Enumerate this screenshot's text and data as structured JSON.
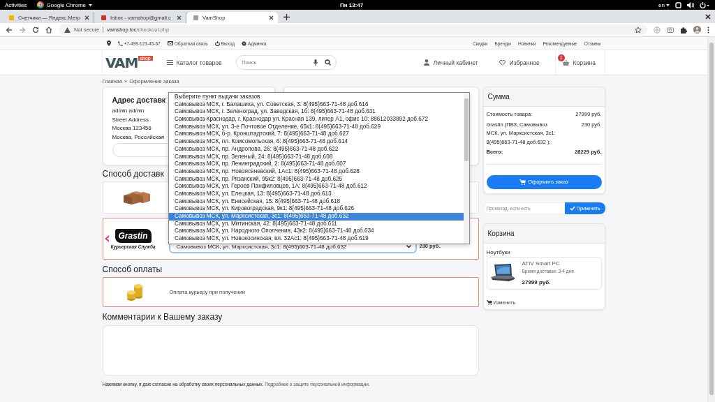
{
  "os_bar": {
    "activities": "Activities",
    "app": "Google Chrome",
    "clock": "Пн 13:47",
    "language": "en"
  },
  "browser": {
    "tabs": [
      {
        "title": "Счетчики — Яндекс.Метр",
        "selected": false,
        "kind": "metrika"
      },
      {
        "title": "Inbox - vamshop@gmail.c",
        "selected": false,
        "kind": "mail"
      },
      {
        "title": "VamShop",
        "selected": true,
        "kind": "page"
      }
    ],
    "security": "Not secure",
    "url_host": "vamshop.loc",
    "url_path": "/checkout.php"
  },
  "topbar": {
    "phone": "+7-499-123-45-67",
    "links_left": [
      "Обратная связь",
      "Выход",
      "Админка"
    ],
    "links_right": [
      "Скидки",
      "Бренды",
      "Новинки",
      "Рекомендуемые",
      "Отзывы"
    ]
  },
  "header": {
    "logo": "VAM",
    "logo_badge": "shop",
    "catalog": "Каталог товаров",
    "search_placeholder": "Поиск",
    "account": "Личный кабинет",
    "favorites": "Избранное",
    "cart": "Корзина",
    "cart_badge": "1"
  },
  "breadcrumb": {
    "items": [
      "Главная",
      "Оформление заказа"
    ],
    "separator": "»"
  },
  "address": {
    "title": "Адрес доставк",
    "lines": [
      "admin admin",
      "Street Address",
      "Москва 123456",
      "Москва, Российская"
    ]
  },
  "delivery": {
    "heading": "Способ доставк",
    "options": [
      {
        "kind": "boxes",
        "selected": false
      },
      {
        "kind": "courier",
        "selected": true,
        "logo": "Grastin",
        "logo_caption": "Курьерская Служба",
        "select_value": "Самовывоз МСК, ул. Марксистская, 3с1: 8(495)663-71-48 доб.632",
        "price": "230 руб."
      }
    ]
  },
  "dropdown": {
    "options": [
      {
        "label": "Выберите пункт выдачи заказов",
        "selected": false
      },
      {
        "label": "Самовывоз МСК, г. Балашиха, ул. Советская, 3: 8(495)663-71-48 доб.616",
        "selected": false
      },
      {
        "label": "Самовывоз МСК, г. Зеленоград, ул. Заводская, 1б: 8(495)663-71-48 доб.631",
        "selected": false
      },
      {
        "label": "Самовывоз Краснодар, г. Краснодар ул. Красная 139, литер А1, офис 10: 88612033892 доб.672",
        "selected": false
      },
      {
        "label": "Самовывоз МСК, ул. 3-е Почтовое Отделение, 65к1: 8(495)663-71-48 доб.629",
        "selected": false
      },
      {
        "label": "Самовывоз МСК, б-р. Кронштадтский, 7: 8(495)663-71-48 доб.627",
        "selected": false
      },
      {
        "label": "Самовывоз МСК, пл. Комсомольская, 6: 8(495)663-71-48 доб.614",
        "selected": false
      },
      {
        "label": "Самовывоз МСК, пр. Андропова, 26: 8(495)663-71-48 доб.622",
        "selected": false
      },
      {
        "label": "Самовывоз МСК, пр. Зеленый, 24: 8(495)663-71-48 доб.608",
        "selected": false
      },
      {
        "label": "Самовывоз МСК, пр. Ленинградский, 2: 8(495)663-71-48 доб.607",
        "selected": false
      },
      {
        "label": "Самовывоз МСК, пр. Новоясеневский, 1Ас1: 8(495)663-71-48 доб.628",
        "selected": false
      },
      {
        "label": "Самовывоз МСК, пр. Рязанский, 95к2: 8(495)663-71-48 доб.625",
        "selected": false
      },
      {
        "label": "Самовывоз МСК, ул. Героев Панфиловцев, 1А: 8(495)663-71-48 доб.612",
        "selected": false
      },
      {
        "label": "Самовывоз МСК, ул. Елецкая, 13: 8(495)663-71-48 доб.613",
        "selected": false
      },
      {
        "label": "Самовывоз МСК, ул. Енисейская, 15: 8(495)663-71-48 доб.618",
        "selected": false
      },
      {
        "label": "Самовывоз МСК, ул. Кировоградская, 9к1: 8(495)663-71-48 доб.626",
        "selected": false
      },
      {
        "label": "Самовывоз МСК, ул. Марксистская, 3с1: 8(495)663-71-48 доб.632",
        "selected": true
      },
      {
        "label": "Самовывоз МСК, ул. Митинская, 42: 8(495)663-71-48 доб.611",
        "selected": false
      },
      {
        "label": "Самовывоз МСК, ул. Народного Ополчения, 43к2: 8(495)663-71-48 доб.634",
        "selected": false
      },
      {
        "label": "Самовывоз МСК, ул. Новокосинская, вл. 32Ас1: 8(495)663-71-48 доб.619",
        "selected": false
      }
    ]
  },
  "payment": {
    "heading": "Способ оплаты",
    "options": [
      {
        "kind": "coins",
        "label": "Оплата курьеру при получении",
        "selected": true
      }
    ]
  },
  "comments": {
    "heading": "Комментарии к Вашему заказу"
  },
  "consent": {
    "text": "Нажимая кнопку, я даю согласие на обработку своих персональных данных.",
    "link": "Подробнее о защите персональной информации."
  },
  "summary": {
    "title": "Сумма",
    "rows": [
      {
        "label": "Стоимость товара:",
        "value": "27999 руб."
      },
      {
        "label": "Grastin (ПВЗ, Самовывоз МСК, ул. Марксистская, 3с1: 8(495)663-71-48 доб.632 ):",
        "value": "230 руб."
      }
    ],
    "total_label": "Всего:",
    "total_value": "28229 руб.",
    "checkout": "Оформить заказ"
  },
  "promo": {
    "placeholder": "Промокод, если есть",
    "button": "Применить"
  },
  "cart": {
    "title": "Корзина",
    "category": "Ноутбуки",
    "items": [
      {
        "name": "ATIV Smart PC",
        "delivery": "Время доставки: 3-4 дня",
        "price": "27999 руб."
      }
    ],
    "edit": "Изменить"
  }
}
